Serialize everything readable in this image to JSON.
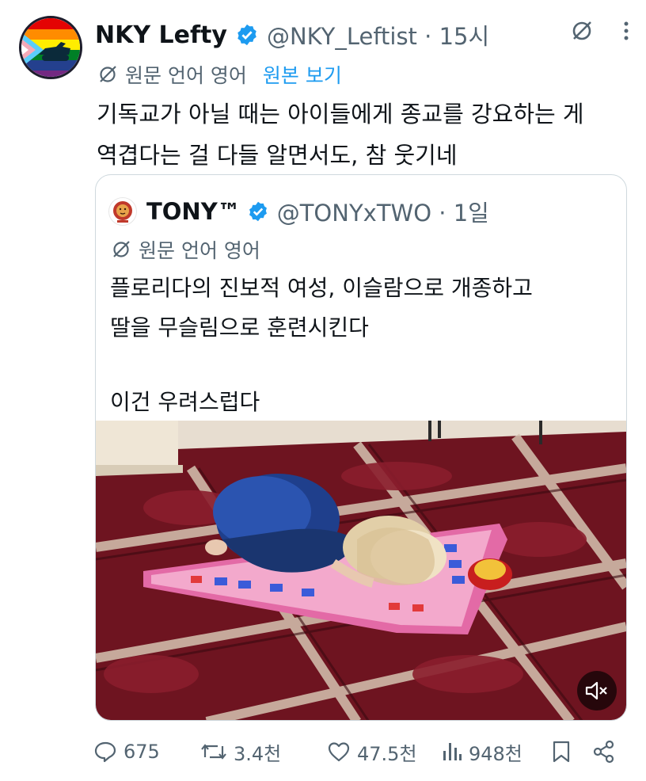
{
  "author": {
    "name": "NKY Lefty",
    "handle": "@NKY_Leftist · 15시"
  },
  "translation": {
    "label": "원문 언어 영어",
    "show_original": "원본 보기"
  },
  "tweet": {
    "line1": "기독교가 아닐 때는 아이들에게 종교를 강요하는 게",
    "line2": "역겹다는 걸 다들 알면서도, 참 웃기네"
  },
  "quote": {
    "name": "TONY™",
    "handle": "@TONYxTWO · 1일",
    "translation_label": "원문 언어 영어",
    "line1": "플로리다의 진보적 여성, 이슬람으로 개종하고",
    "line2": "딸을 무슬림으로 훈련시킨다",
    "line3": "이건 우려스럽다"
  },
  "actions": {
    "replies": "675",
    "reposts": "3.4천",
    "likes": "47.5천",
    "views": "948천"
  },
  "colors": {
    "accent": "#1d9bf0",
    "secondary_text": "#536471",
    "rug_red": "#6e1420"
  },
  "icons": [
    "grok-icon",
    "more-icon",
    "translate-icon",
    "verified-icon",
    "reply-icon",
    "repost-icon",
    "like-icon",
    "views-icon",
    "bookmark-icon",
    "share-icon",
    "mute-icon"
  ]
}
